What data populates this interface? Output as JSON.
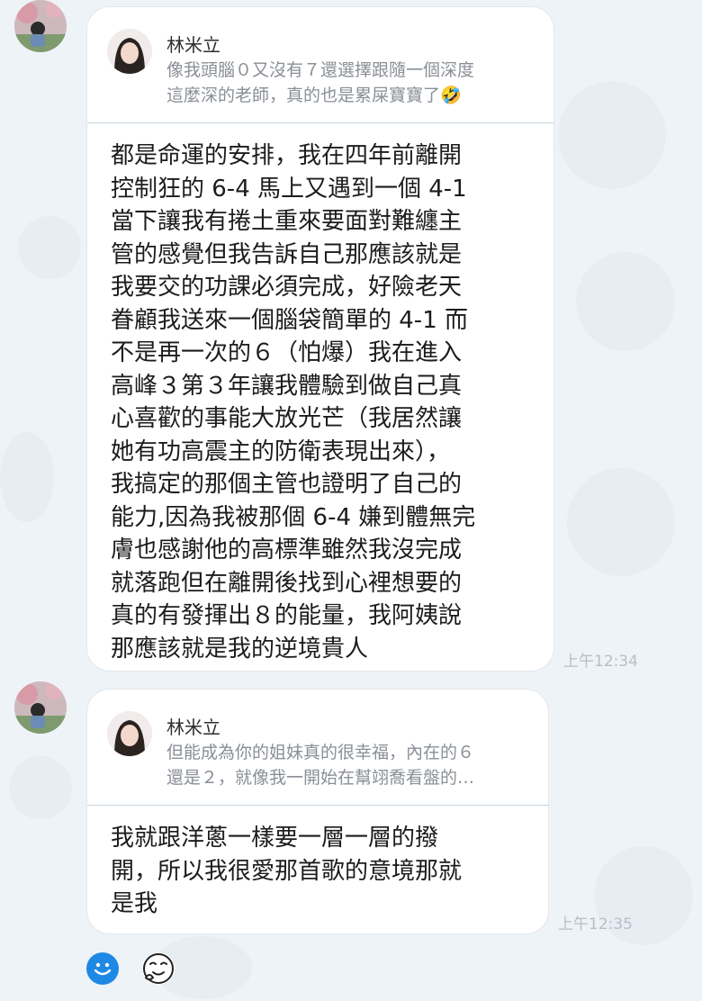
{
  "messages": [
    {
      "sender": "林米立",
      "quote_text": "像我頭腦０又沒有７還選擇跟隨一個深度\n這麼深的老師，真的也是累屎寶寶了🤣",
      "text": "都是命運的安排，我在四年前離開\n控制狂的 6-4 馬上又遇到一個 4-1\n當下讓我有捲土重來要面對難纏主\n管的感覺但我告訴自己那應該就是\n我要交的功課必須完成，好險老天\n眷顧我送來一個腦袋簡單的 4-1 而\n不是再一次的６（怕爆）我在進入\n高峰３第３年讓我體驗到做自己真\n心喜歡的事能大放光芒（我居然讓\n她有功高震主的防衛表現出來），\n我搞定的那個主管也證明了自己的\n能力,因為我被那個 6-4 嫌到體無完\n膚也感謝他的高標準雖然我沒完成\n就落跑但在離開後找到心裡想要的\n真的有發揮出８的能量，我阿姨說\n那應該就是我的逆境貴人",
      "time": "上午12:34"
    },
    {
      "sender": "林米立",
      "quote_text": "但能成為你的姐妹真的很幸福，內在的６\n還是２，就像我一開始在幫翊喬看盤的…",
      "text": "我就跟洋蔥一樣要一層一層的撥\n開，所以我很愛那首歌的意境那就\n是我",
      "time": "上午12:35"
    }
  ],
  "icons": {
    "emoji_button": "smiley-face-icon",
    "sticker_button": "sticker-face-icon"
  },
  "colors": {
    "background": "#eef3f7",
    "bubble": "#ffffff",
    "accent": "#1e88e5",
    "time": "#b7bec6"
  }
}
